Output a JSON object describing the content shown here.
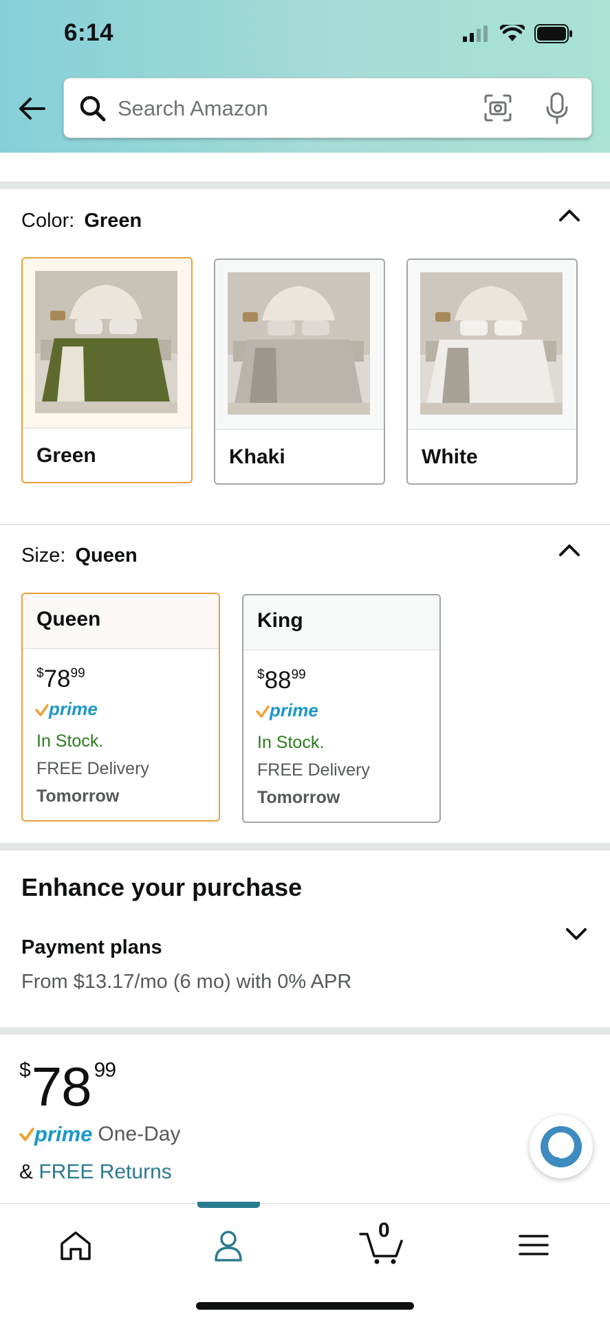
{
  "status_bar": {
    "time": "6:14"
  },
  "search": {
    "placeholder": "Search Amazon"
  },
  "color_section": {
    "label": "Color:",
    "selected": "Green",
    "options": [
      {
        "name": "Green",
        "selected": true
      },
      {
        "name": "Khaki",
        "selected": false
      },
      {
        "name": "White",
        "selected": false
      }
    ]
  },
  "size_section": {
    "label": "Size:",
    "selected": "Queen",
    "options": [
      {
        "name": "Queen",
        "currency": "$",
        "price_whole": "78",
        "price_cents": "99",
        "prime": "prime",
        "stock": "In Stock.",
        "delivery": "FREE Delivery",
        "delivery_day": "Tomorrow",
        "selected": true
      },
      {
        "name": "King",
        "currency": "$",
        "price_whole": "88",
        "price_cents": "99",
        "prime": "prime",
        "stock": "In Stock.",
        "delivery": "FREE Delivery",
        "delivery_day": "Tomorrow",
        "selected": false
      }
    ]
  },
  "enhance": {
    "title": "Enhance your purchase",
    "payment_plans_title": "Payment plans",
    "payment_plans_sub": "From $13.17/mo (6 mo) with 0% APR"
  },
  "buybox": {
    "currency": "$",
    "price_whole": "78",
    "price_cents": "99",
    "prime": "prime",
    "prime_text": "One-Day",
    "returns_prefix": "&",
    "returns_link": "FREE Returns"
  },
  "bottom_nav": {
    "cart_count": "0",
    "items": [
      "home-icon",
      "account-icon",
      "cart-icon",
      "menu-icon"
    ],
    "active": "account-icon"
  },
  "colors": {
    "accent": "#2a7b8d",
    "selected_border": "#e7a23b",
    "in_stock": "#2b7d1d",
    "prime_blue": "#1a98c7",
    "prime_check": "#f0a030"
  }
}
